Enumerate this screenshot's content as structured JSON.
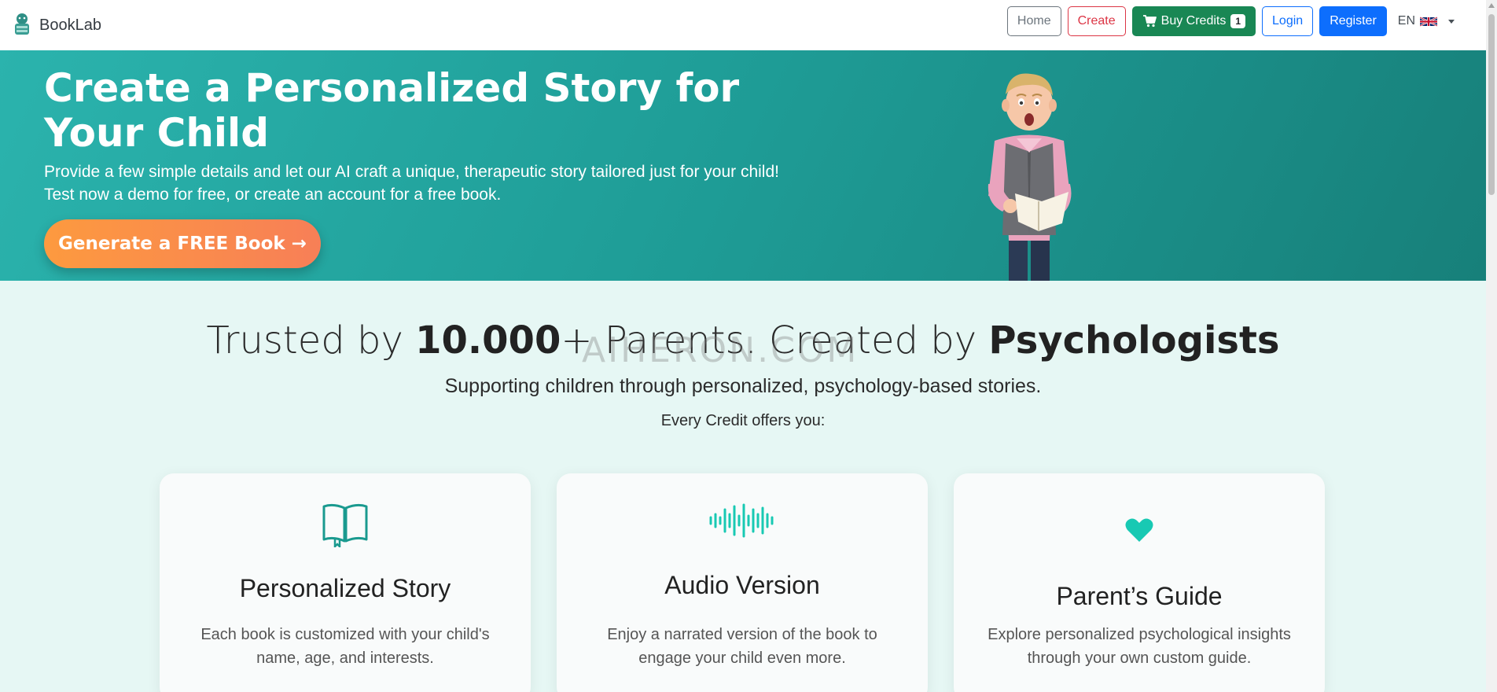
{
  "navbar": {
    "brand": "BookLab",
    "home_label": "Home",
    "create_label": "Create",
    "buy_label": "Buy Credits",
    "credits_count": "1",
    "login_label": "Login",
    "register_label": "Register",
    "language": "EN"
  },
  "hero": {
    "title": "Create a Personalized Story for Your Child",
    "text": "Provide a few simple details and let our AI craft a unique, therapeutic story tailored just for your child! Test now a demo for free, or create an account for a free book.",
    "cta_label": "Generate a FREE Book",
    "cta_arrow": "→"
  },
  "trust": {
    "title_prefix": "Trusted by ",
    "title_number": "10.000",
    "title_middle": "+ Parents. Created by ",
    "title_bold": "Psychologists",
    "watermark": "AIHERON.COM",
    "subtitle": "Supporting children through personalized, psychology-based stories.",
    "every_credit": "Every Credit offers you:"
  },
  "features": [
    {
      "title": "Personalized Story",
      "text": "Each book is customized with your child's name, age, and interests.",
      "icon": "book-icon"
    },
    {
      "title": "Audio Version",
      "text": "Enjoy a narrated version of the book to engage your child even more.",
      "icon": "audio-wave-icon"
    },
    {
      "title": "Parent’s Guide",
      "text": "Explore personalized psychological insights through your own custom guide.",
      "icon": "heart-icon"
    }
  ],
  "colors": {
    "teal": "#1f9e98",
    "orange": "#fd9a3f",
    "green": "#198754",
    "blue": "#0d6efd",
    "red": "#dc3545",
    "icon_teal": "#18c9b3"
  }
}
